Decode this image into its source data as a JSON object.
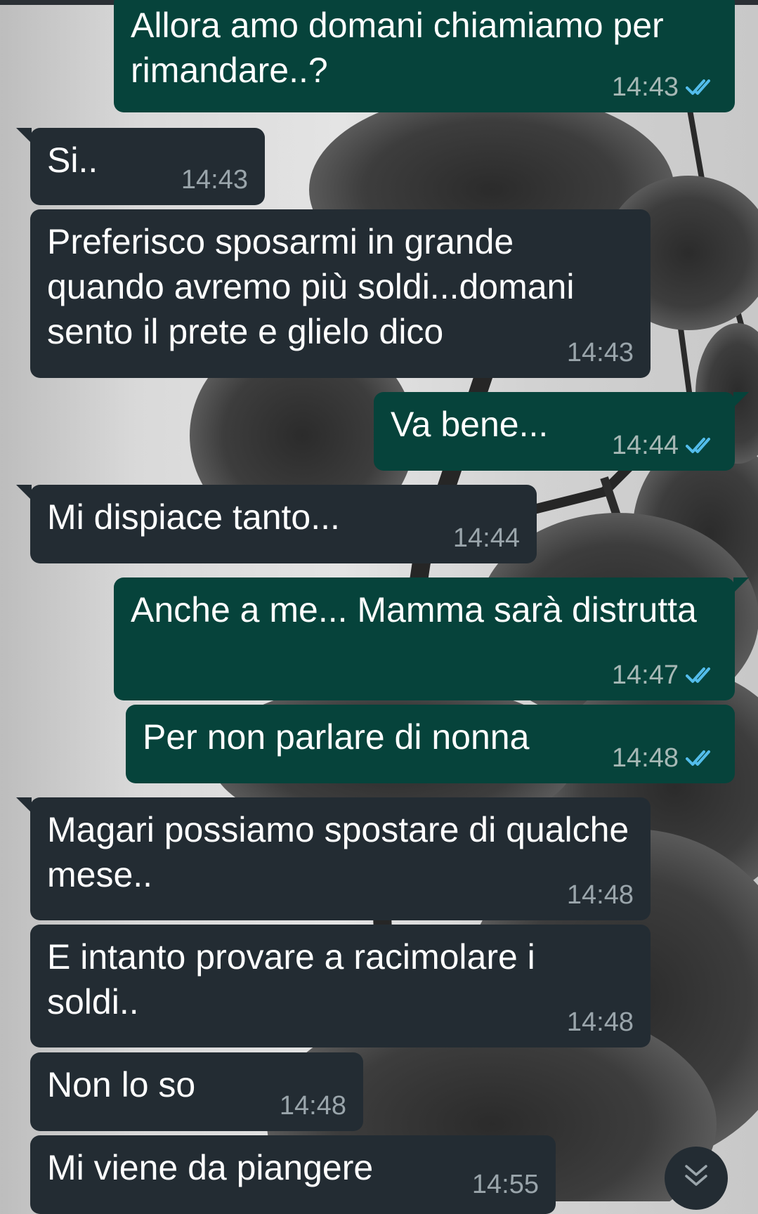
{
  "colors": {
    "incoming_bubble": "#232c33",
    "outgoing_bubble": "#06433b",
    "timestamp": "#9aa5ab",
    "read_tick": "#53bdeb"
  },
  "messages": [
    {
      "direction": "out",
      "text": "Allora amo domani chiamiamo per rimandare..?",
      "time": "14:43",
      "status": "read",
      "tail": false
    },
    {
      "direction": "in",
      "text": "Si..",
      "time": "14:43",
      "tail": true
    },
    {
      "direction": "in",
      "text": "Preferisco sposarmi in grande quando avremo più soldi...domani sento il prete e glielo dico",
      "time": "14:43",
      "tail": false
    },
    {
      "direction": "out",
      "text": "Va bene...",
      "time": "14:44",
      "status": "read",
      "tail": true
    },
    {
      "direction": "in",
      "text": "Mi dispiace tanto...",
      "time": "14:44",
      "tail": true
    },
    {
      "direction": "out",
      "text": "Anche a me... Mamma sarà distrutta",
      "time": "14:47",
      "status": "read",
      "tail": true
    },
    {
      "direction": "out",
      "text": "Per non parlare di nonna",
      "time": "14:48",
      "status": "read",
      "tail": false
    },
    {
      "direction": "in",
      "text": "Magari possiamo spostare di qualche mese..",
      "time": "14:48",
      "tail": true
    },
    {
      "direction": "in",
      "text": "E intanto provare a racimolare i soldi..",
      "time": "14:48",
      "tail": false
    },
    {
      "direction": "in",
      "text": "Non lo so",
      "time": "14:48",
      "tail": false
    },
    {
      "direction": "in",
      "text": "Mi viene da piangere",
      "time": "14:55",
      "tail": false
    }
  ],
  "scroll_button": {
    "icon": "double-chevron-down-icon"
  }
}
